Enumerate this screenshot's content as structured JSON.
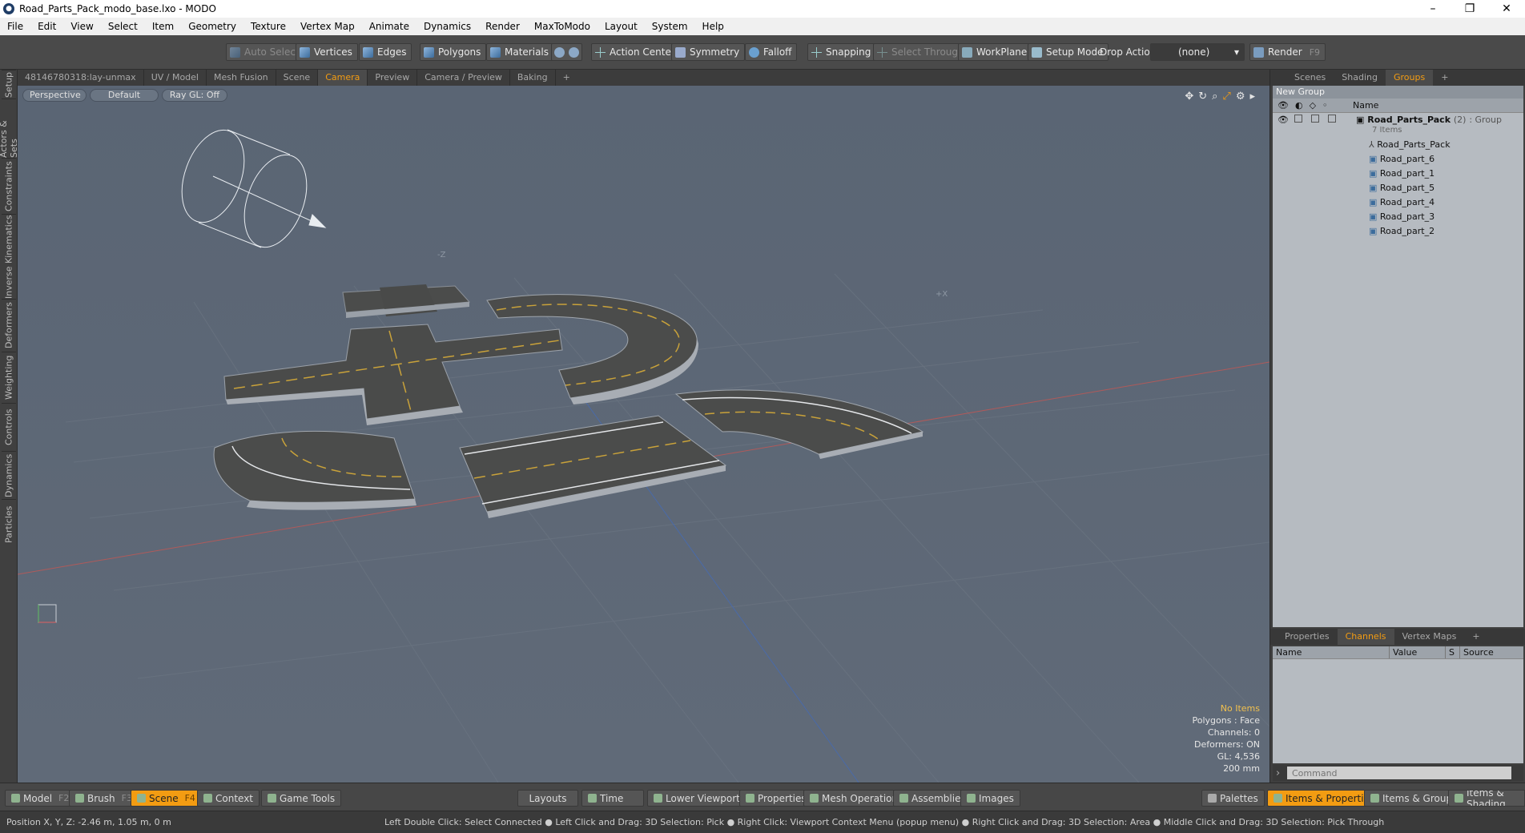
{
  "window": {
    "title": "Road_Parts_Pack_modo_base.lxo - MODO",
    "controls": [
      "–",
      "❐",
      "✕"
    ]
  },
  "menu": [
    "File",
    "Edit",
    "View",
    "Select",
    "Item",
    "Geometry",
    "Texture",
    "Vertex Map",
    "Animate",
    "Dynamics",
    "Render",
    "MaxToModo",
    "Layout",
    "System",
    "Help"
  ],
  "toolbar": {
    "auto_select": "Auto Select",
    "vertices": "Vertices",
    "edges": "Edges",
    "polygons": "Polygons",
    "materials": "Materials",
    "action_center": "Action Center",
    "symmetry": "Symmetry",
    "falloff": "Falloff",
    "snapping": "Snapping",
    "select_through": "Select Through",
    "workplane": "WorkPlane",
    "setup_mode": "Setup Mode",
    "drop_action": "Drop Action",
    "drop_value": "(none)",
    "render": "Render",
    "render_key": "F9"
  },
  "left_tabs": [
    "Setup",
    "Actors & Sets",
    "Constraints",
    "Inverse Kinematics",
    "Deformers",
    "Weighting",
    "Controls",
    "Dynamics",
    "Particles"
  ],
  "viewport_tabs": [
    "48146780318:lay-unmax",
    "UV / Model",
    "Mesh Fusion",
    "Scene",
    "Camera",
    "Preview",
    "Camera / Preview",
    "Baking",
    "+"
  ],
  "viewport_tab_active": "Camera",
  "viewport": {
    "view": "Perspective",
    "shading": "Default",
    "raygl": "Ray GL: Off",
    "axis_minus_z": "-Z",
    "axis_plus_x": "+X",
    "info": {
      "items": "No Items",
      "polygons": "Polygons : Face",
      "channels": "Channels: 0",
      "deformers": "Deformers: ON",
      "gl": "GL: 4,536",
      "scale": "200 mm"
    }
  },
  "right_tabs": [
    "Scenes",
    "Shading",
    "Groups",
    "+"
  ],
  "right_tab_active": "Groups",
  "groups": {
    "new_group": "New Group",
    "col_name": "Name",
    "root": "Road_Parts_Pack",
    "root_count": "(2)",
    "root_type": ": Group",
    "root_sub": "7 Items",
    "children": [
      "Road_Parts_Pack",
      "Road_part_6",
      "Road_part_1",
      "Road_part_5",
      "Road_part_4",
      "Road_part_3",
      "Road_part_2"
    ]
  },
  "lower_tabs": [
    "Properties",
    "Channels",
    "Vertex Maps",
    "+"
  ],
  "lower_tab_active": "Channels",
  "channels": {
    "name": "Name",
    "value": "Value",
    "s": "S",
    "source": "Source"
  },
  "command_placeholder": "Command",
  "layout_bar": {
    "model": "Model",
    "model_key": "F2",
    "brush": "Brush",
    "brush_key": "F3",
    "scene": "Scene",
    "scene_key": "F4",
    "context": "Context",
    "game_tools": "Game Tools",
    "layouts": "Layouts",
    "time": "Time",
    "lower_viewports": "Lower Viewports",
    "properties": "Properties",
    "mesh_operations": "Mesh Operations",
    "assemblies": "Assemblies",
    "images": "Images",
    "palettes": "Palettes",
    "items_properties": "Items & Properties",
    "items_groups": "Items & Groups",
    "items_shading": "Items & Shading"
  },
  "status": {
    "position": "Position X, Y, Z:   -2.46 m, 1.05 m, 0 m",
    "hint": "Left Double Click: Select Connected ● Left Click and Drag: 3D Selection: Pick ● Right Click: Viewport Context Menu (popup menu) ● Right Click and Drag: 3D Selection: Area ● Middle Click and Drag: 3D Selection: Pick Through"
  },
  "colors": {
    "accent": "#f39c12",
    "viewport_bg": "#5d6877",
    "asphalt": "#4a4b4a",
    "road_side": "#a8adb4",
    "line_yellow": "#c9a23a"
  }
}
